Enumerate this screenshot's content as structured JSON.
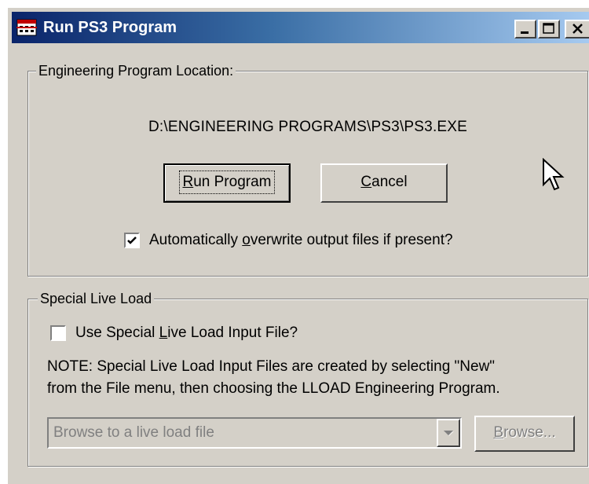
{
  "window": {
    "title": "Run PS3 Program",
    "icon": "app-icon",
    "controls": [
      "minimize-icon",
      "maximize-icon",
      "close-icon"
    ]
  },
  "program_group": {
    "legend": "Engineering Program Location:",
    "path": "D:\\ENGINEERING PROGRAMS\\PS3\\PS3.EXE",
    "run_button": {
      "pre": "",
      "mnemonic": "R",
      "post": "un Program"
    },
    "cancel_button": {
      "pre": "",
      "mnemonic": "C",
      "post": "ancel"
    },
    "overwrite_checkbox": {
      "checked": true,
      "pre": "Automatically ",
      "mnemonic": "o",
      "post": "verwrite output files if present?"
    }
  },
  "live_load_group": {
    "legend": "Special Live Load",
    "use_checkbox": {
      "checked": false,
      "pre": "Use Special ",
      "mnemonic": "L",
      "post": "ive Load Input File?"
    },
    "note_line1": "NOTE: Special Live Load Input Files are created by selecting \"New\"",
    "note_line2": "from the File menu, then choosing the LLOAD Engineering Program.",
    "combo_placeholder": "Browse to a live load file",
    "browse_button": {
      "pre": "",
      "mnemonic": "B",
      "post": "rowse..."
    }
  },
  "colors": {
    "face": "#d4d0c8",
    "title_start": "#0a246a",
    "title_end": "#a6caf0"
  }
}
